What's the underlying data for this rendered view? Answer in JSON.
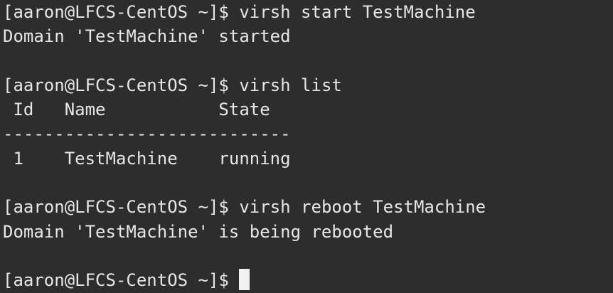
{
  "terminal": {
    "theme": {
      "background": "#2d2d2d",
      "foreground": "#e6e6e6",
      "cursor": "#f2f2f2"
    },
    "lines": [
      {
        "prompt": "[aaron@LFCS-CentOS ~]$",
        "command": "virsh start TestMachine"
      },
      {
        "output": "Domain 'TestMachine' started"
      },
      {
        "output": ""
      },
      {
        "prompt": "[aaron@LFCS-CentOS ~]$",
        "command": "virsh list"
      },
      {
        "output": " Id   Name           State"
      },
      {
        "output": "----------------------------"
      },
      {
        "output": " 1    TestMachine    running"
      },
      {
        "output": ""
      },
      {
        "prompt": "[aaron@LFCS-CentOS ~]$",
        "command": "virsh reboot TestMachine"
      },
      {
        "output": "Domain 'TestMachine' is being rebooted"
      },
      {
        "output": ""
      },
      {
        "prompt": "[aaron@LFCS-CentOS ~]$",
        "command": ""
      }
    ]
  }
}
